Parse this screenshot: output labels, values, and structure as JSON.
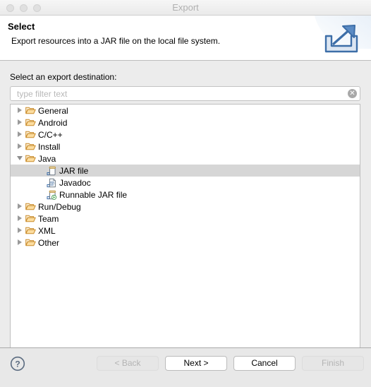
{
  "window": {
    "title": "Export",
    "traffic_lights": [
      "close-button",
      "minimize-button",
      "zoom-button"
    ]
  },
  "header": {
    "title": "Select",
    "description": "Export resources into a JAR file on the local file system.",
    "icon": "export-icon"
  },
  "main": {
    "field_label": "Select an export destination:",
    "filter": {
      "value": "",
      "placeholder": "type filter text",
      "clear_label": "✕"
    },
    "tree": [
      {
        "label": "General",
        "icon": "folder-icon",
        "state": "collapsed",
        "level": 0,
        "selected": false
      },
      {
        "label": "Android",
        "icon": "folder-icon",
        "state": "collapsed",
        "level": 0,
        "selected": false
      },
      {
        "label": "C/C++",
        "icon": "folder-icon",
        "state": "collapsed",
        "level": 0,
        "selected": false
      },
      {
        "label": "Install",
        "icon": "folder-icon",
        "state": "collapsed",
        "level": 0,
        "selected": false
      },
      {
        "label": "Java",
        "icon": "folder-icon",
        "state": "expanded",
        "level": 0,
        "selected": false
      },
      {
        "label": "JAR file",
        "icon": "jar-file-icon",
        "state": "leaf",
        "level": 1,
        "selected": true
      },
      {
        "label": "Javadoc",
        "icon": "javadoc-icon",
        "state": "leaf",
        "level": 1,
        "selected": false
      },
      {
        "label": "Runnable JAR file",
        "icon": "runnable-jar-icon",
        "state": "leaf",
        "level": 1,
        "selected": false
      },
      {
        "label": "Run/Debug",
        "icon": "folder-icon",
        "state": "collapsed",
        "level": 0,
        "selected": false
      },
      {
        "label": "Team",
        "icon": "folder-icon",
        "state": "collapsed",
        "level": 0,
        "selected": false
      },
      {
        "label": "XML",
        "icon": "folder-icon",
        "state": "collapsed",
        "level": 0,
        "selected": false
      },
      {
        "label": "Other",
        "icon": "folder-icon",
        "state": "collapsed",
        "level": 0,
        "selected": false
      }
    ]
  },
  "footer": {
    "help_icon": "help-icon",
    "buttons": [
      {
        "id": "btn-back",
        "name": "back-button",
        "label": "< Back",
        "enabled": false
      },
      {
        "id": "btn-next",
        "name": "next-button",
        "label": "Next >",
        "enabled": true
      },
      {
        "id": "btn-cancel",
        "name": "cancel-button",
        "label": "Cancel",
        "enabled": true
      },
      {
        "id": "btn-finish",
        "name": "finish-button",
        "label": "Finish",
        "enabled": false
      }
    ]
  },
  "colors": {
    "titlebar_text": "#b0b0b0",
    "body_background": "#ececec",
    "selection": "#d6d6d6",
    "folder_icon": "#e8a33d",
    "export_icon": "#3d6ea8"
  }
}
